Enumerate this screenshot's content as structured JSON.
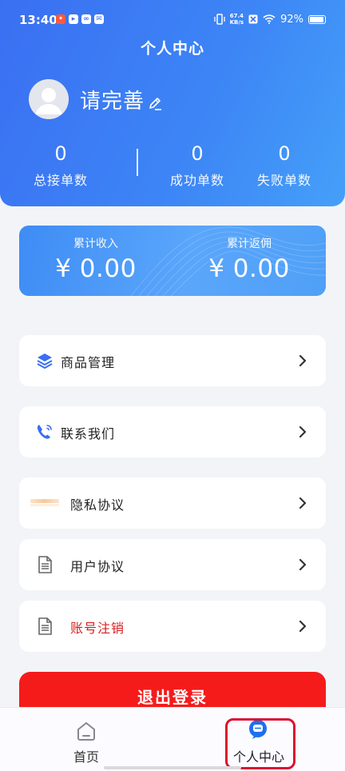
{
  "status_bar": {
    "time": "13:40",
    "net_speed_value": "67.4",
    "net_speed_unit": "KB/s",
    "battery": "92%"
  },
  "page_title": "个人中心",
  "profile": {
    "name": "请完善"
  },
  "stats": [
    {
      "value": "0",
      "label": "总接单数"
    },
    {
      "value": "0",
      "label": "成功单数"
    },
    {
      "value": "0",
      "label": "失败单数"
    }
  ],
  "earnings": {
    "income_label": "累计收入",
    "income_value": "¥ 0.00",
    "rebate_label": "累计返佣",
    "rebate_value": "¥ 0.00"
  },
  "menu": {
    "items": [
      {
        "label": "商品管理",
        "icon": "layers-icon"
      },
      {
        "label": "联系我们",
        "icon": "phone-icon"
      },
      {
        "label": "隐私协议",
        "icon": "privacy-icon"
      },
      {
        "label": "用户协议",
        "icon": "document-icon"
      },
      {
        "label": "账号注销",
        "icon": "document-icon"
      }
    ]
  },
  "logout_label": "退出登录",
  "tabbar": {
    "tabs": [
      {
        "label": "首页",
        "icon": "home-icon"
      },
      {
        "label": "个人中心",
        "icon": "chat-bubble-icon"
      }
    ]
  },
  "colors": {
    "header_blue": "#3d86f6",
    "danger_red": "#f51b1b",
    "cancel_text": "#d81e1e",
    "highlight_border": "#d9142f"
  }
}
